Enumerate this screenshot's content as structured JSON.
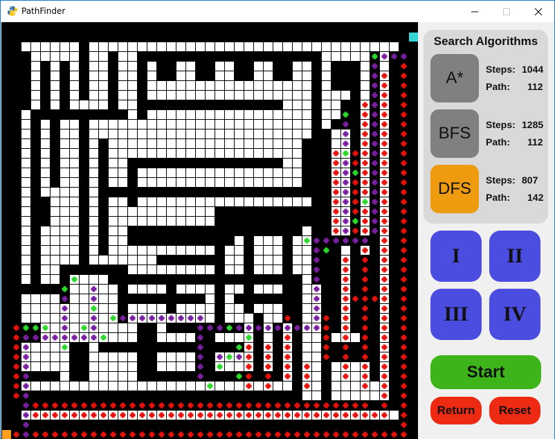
{
  "window": {
    "title": "PathFinder",
    "controls": [
      "minimize",
      "maximize",
      "close"
    ]
  },
  "maze": {
    "icons": {
      "app": "python-icon"
    },
    "colors": {
      "wall": "#000000",
      "open": "#ffffff",
      "visited": "#7b1fa2",
      "frontier": "#2bd92b",
      "path": "#e8120c",
      "start": "#ff9f1a",
      "goal": "#33d6d6"
    }
  },
  "sidebar": {
    "title": "Search Algorithms",
    "algorithms": [
      {
        "label": "A*",
        "steps_label": "Steps:",
        "steps": "1044",
        "path_label": "Path:",
        "path": "112",
        "color": "#808080"
      },
      {
        "label": "BFS",
        "steps_label": "Steps:",
        "steps": "1285",
        "path_label": "Path:",
        "path": "112",
        "color": "#808080"
      },
      {
        "label": "DFS",
        "steps_label": "Steps:",
        "steps": "807",
        "path_label": "Path:",
        "path": "142",
        "color": "#ee9b10"
      }
    ],
    "mazes": [
      "I",
      "II",
      "III",
      "IV"
    ],
    "start_label": "Start",
    "return_label": "Return",
    "reset_label": "Reset"
  }
}
